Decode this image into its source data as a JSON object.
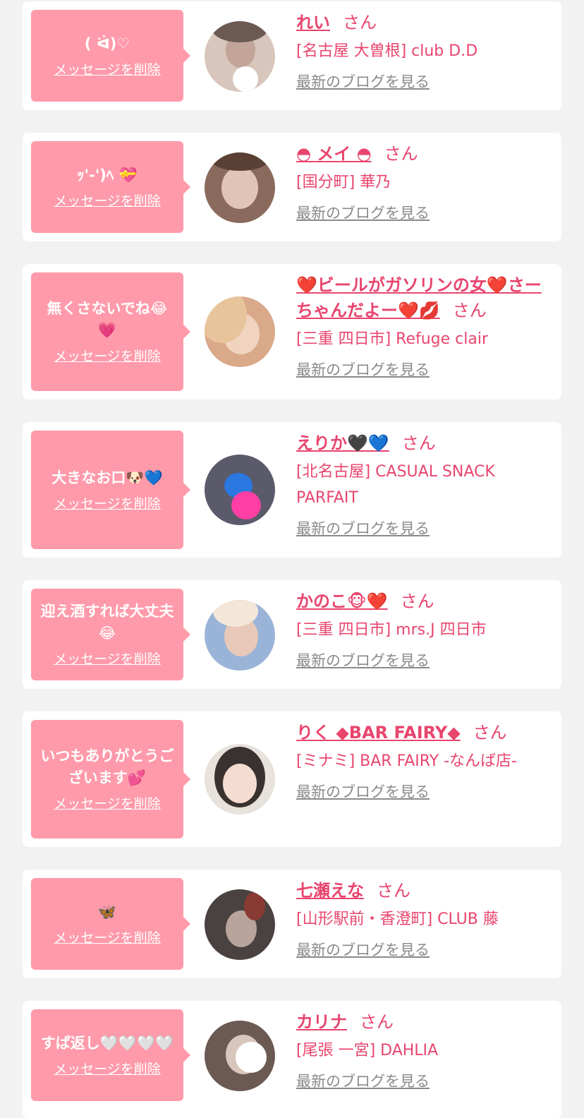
{
  "common": {
    "delete_label": "メッセージを削除",
    "honorific": "さん",
    "blog_label": "最新のブログを見る"
  },
  "cards": [
    {
      "message": "( ᐛ)♡",
      "name": "れい",
      "shop": "[名古屋 大曽根] club D.D",
      "avatar_colors": [
        "#d8c6bc",
        "#6a5a52"
      ]
    },
    {
      "message": "ｯ'-')ﾍ 💝",
      "name": "◓ メイ ◓",
      "shop": "[国分町] 華乃",
      "avatar_colors": [
        "#8a6a5c",
        "#e0c4b8"
      ]
    },
    {
      "message": "無くさないでね😂💗",
      "name": "❤️ビールがガソリンの女❤️さーちゃんだよー❤️💋",
      "shop": "[三重 四日市] Refuge clair",
      "avatar_colors": [
        "#d9a98a",
        "#f0d4c0"
      ]
    },
    {
      "message": "大きなお口🐶💙",
      "name": "えりか🖤💙",
      "shop": "[北名古屋] CASUAL SNACK PARFAIT",
      "avatar_colors": [
        "#5a5a6a",
        "#2a78e0"
      ]
    },
    {
      "message": "迎え酒すれば大丈夫😂",
      "name": "かのこ🐵❤️",
      "shop": "[三重 四日市] mrs.J 四日市",
      "avatar_colors": [
        "#9ab4d8",
        "#e8c8b8"
      ]
    },
    {
      "message": "いつもありがとうございます💕",
      "name": "りく ◆BAR FAIRY◆",
      "shop": "[ミナミ] BAR FAIRY -なんば店-",
      "avatar_colors": [
        "#e8e2dc",
        "#3a3230"
      ]
    },
    {
      "message": "🦋",
      "name": "七瀬えな",
      "shop": "[山形駅前・香澄町] CLUB 藤",
      "avatar_colors": [
        "#4a4240",
        "#b8a49a"
      ]
    },
    {
      "message": "すぱ返し🤍🤍🤍🤍",
      "name": "カリナ",
      "shop": "[尾張 一宮] DAHLIA",
      "avatar_colors": [
        "#6a5a52",
        "#d8c6bc"
      ]
    }
  ]
}
